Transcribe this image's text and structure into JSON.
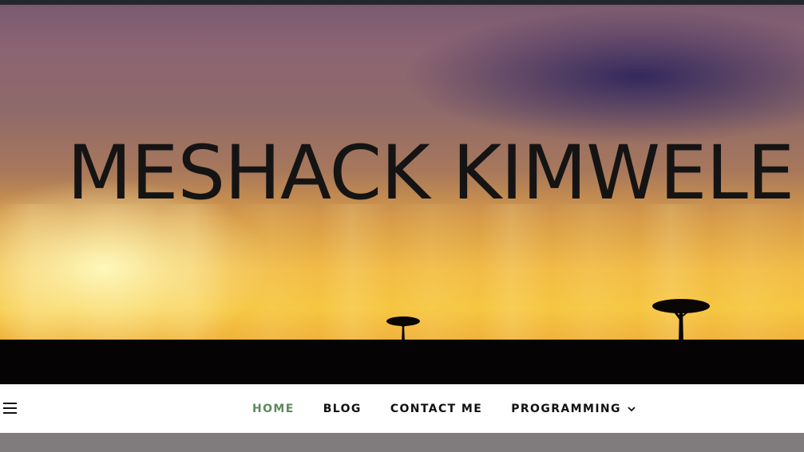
{
  "site": {
    "title": "MESHACK KIMWELE"
  },
  "nav": {
    "menu_icon": "hamburger-menu-icon",
    "items": [
      {
        "label": "HOME",
        "active": true
      },
      {
        "label": "BLOG",
        "active": false
      },
      {
        "label": "CONTACT ME",
        "active": false
      },
      {
        "label": "PROGRAMMING",
        "active": false,
        "has_dropdown": true,
        "dropdown_icon": "chevron-down-icon"
      }
    ]
  },
  "colors": {
    "active_nav": "#5e8a5a",
    "text": "#111111",
    "topbar": "#23282d",
    "content_bg": "#807c7e"
  }
}
